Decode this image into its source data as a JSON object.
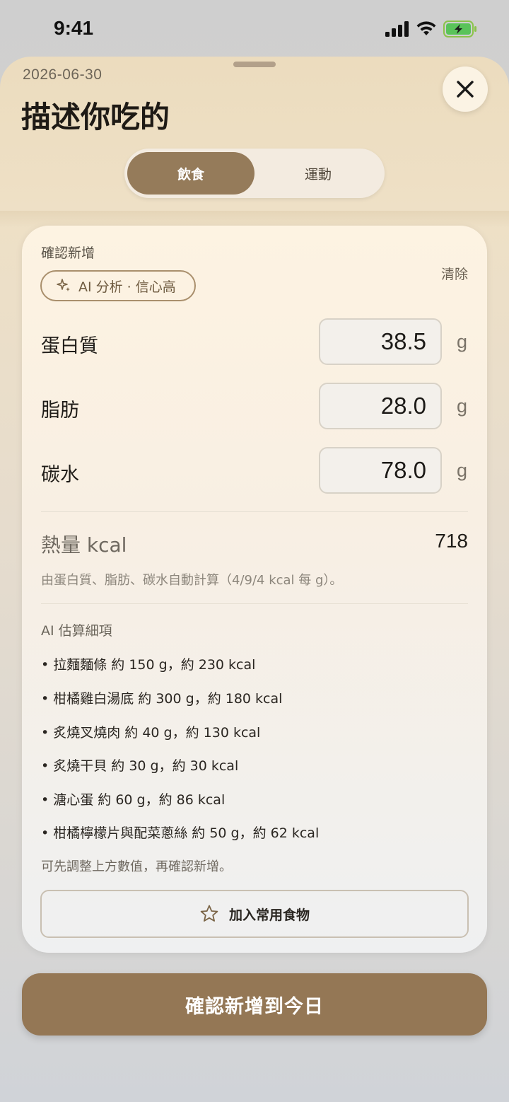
{
  "status_bar": {
    "time": "9:41"
  },
  "sheet": {
    "date": "2026-06-30",
    "title": "描述你吃的",
    "tabs": [
      {
        "label": "飲食",
        "selected": true
      },
      {
        "label": "運動",
        "selected": false
      }
    ]
  },
  "card": {
    "confirm_label": "確認新增",
    "clear_label": "清除",
    "ai_chip": "AI 分析 · 信心高",
    "macros": [
      {
        "label": "蛋白質",
        "value": "38.5",
        "unit": "g"
      },
      {
        "label": "脂肪",
        "value": "28.0",
        "unit": "g"
      },
      {
        "label": "碳水",
        "value": "78.0",
        "unit": "g"
      }
    ],
    "kcal_label": "熱量 kcal",
    "kcal_value": "718",
    "kcal_note": "由蛋白質、脂肪、碳水自動計算（4/9/4 kcal 每 g）。",
    "ai_breakdown_title": "AI 估算細項",
    "ai_items": [
      "• 拉麵麵條 約 150 g，約 230 kcal",
      "• 柑橘雞白湯底 約 300 g，約 180 kcal",
      "• 炙燒叉燒肉 約 40 g，約 130 kcal",
      "• 炙燒干貝 約 30 g，約 30 kcal",
      "• 溏心蛋 約 60 g，約 86 kcal",
      "• 柑橘檸檬片與配菜蔥絲 約 50 g，約 62 kcal"
    ],
    "hint": "可先調整上方數值，再確認新增。",
    "favorite_button": "加入常用食物"
  },
  "cta_button": "確認新增到今日",
  "colors": {
    "accent": "#957b5a",
    "cta": "#947755"
  }
}
